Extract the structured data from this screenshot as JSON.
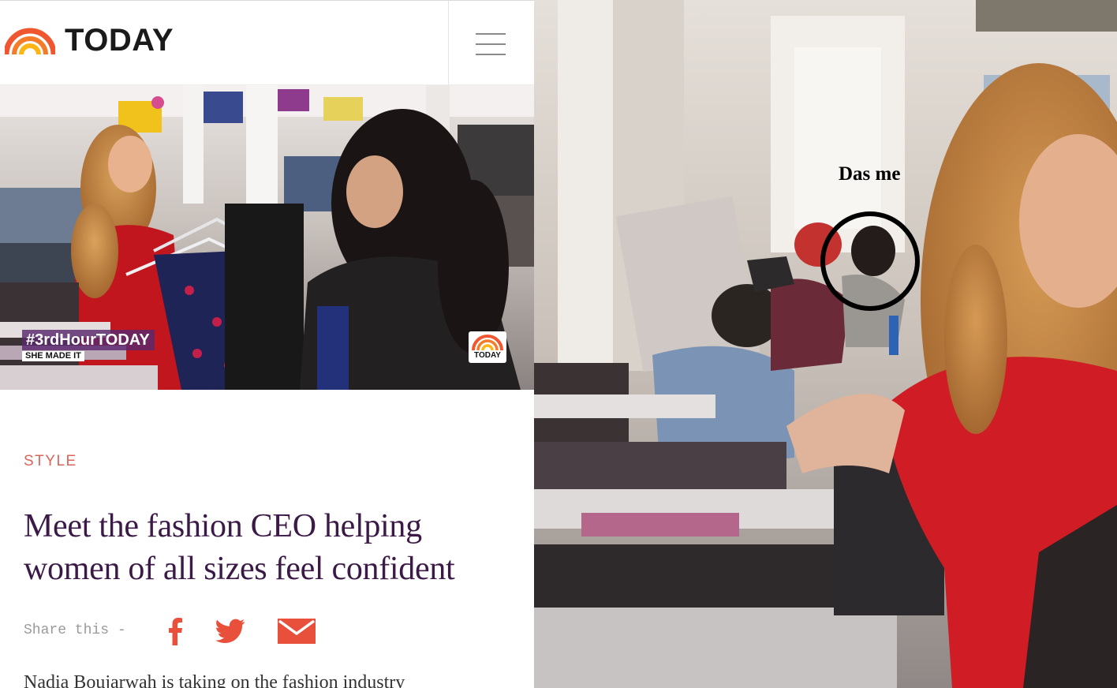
{
  "header": {
    "logo_text": "TODAY",
    "menu_icon": "hamburger-menu-icon"
  },
  "hero": {
    "hashtag": "#3rdHourTODAY",
    "segment": "SHE MADE IT",
    "bug_text": "TODAY"
  },
  "article": {
    "kicker": "STYLE",
    "headline": "Meet the fashion CEO helping women of all sizes feel confident",
    "share_label": "Share this -",
    "share_icons": [
      "facebook-icon",
      "twitter-icon",
      "email-icon"
    ],
    "body_preview": "Nadia Boujarwah is taking on the fashion industry"
  },
  "annotation": {
    "label": "Das me"
  },
  "colors": {
    "kicker": "#d8665a",
    "headline": "#3c1a47",
    "share_icons": "#e8503c",
    "logo_arc_outer": "#f0562f",
    "logo_arc_inner": "#fdb515"
  }
}
